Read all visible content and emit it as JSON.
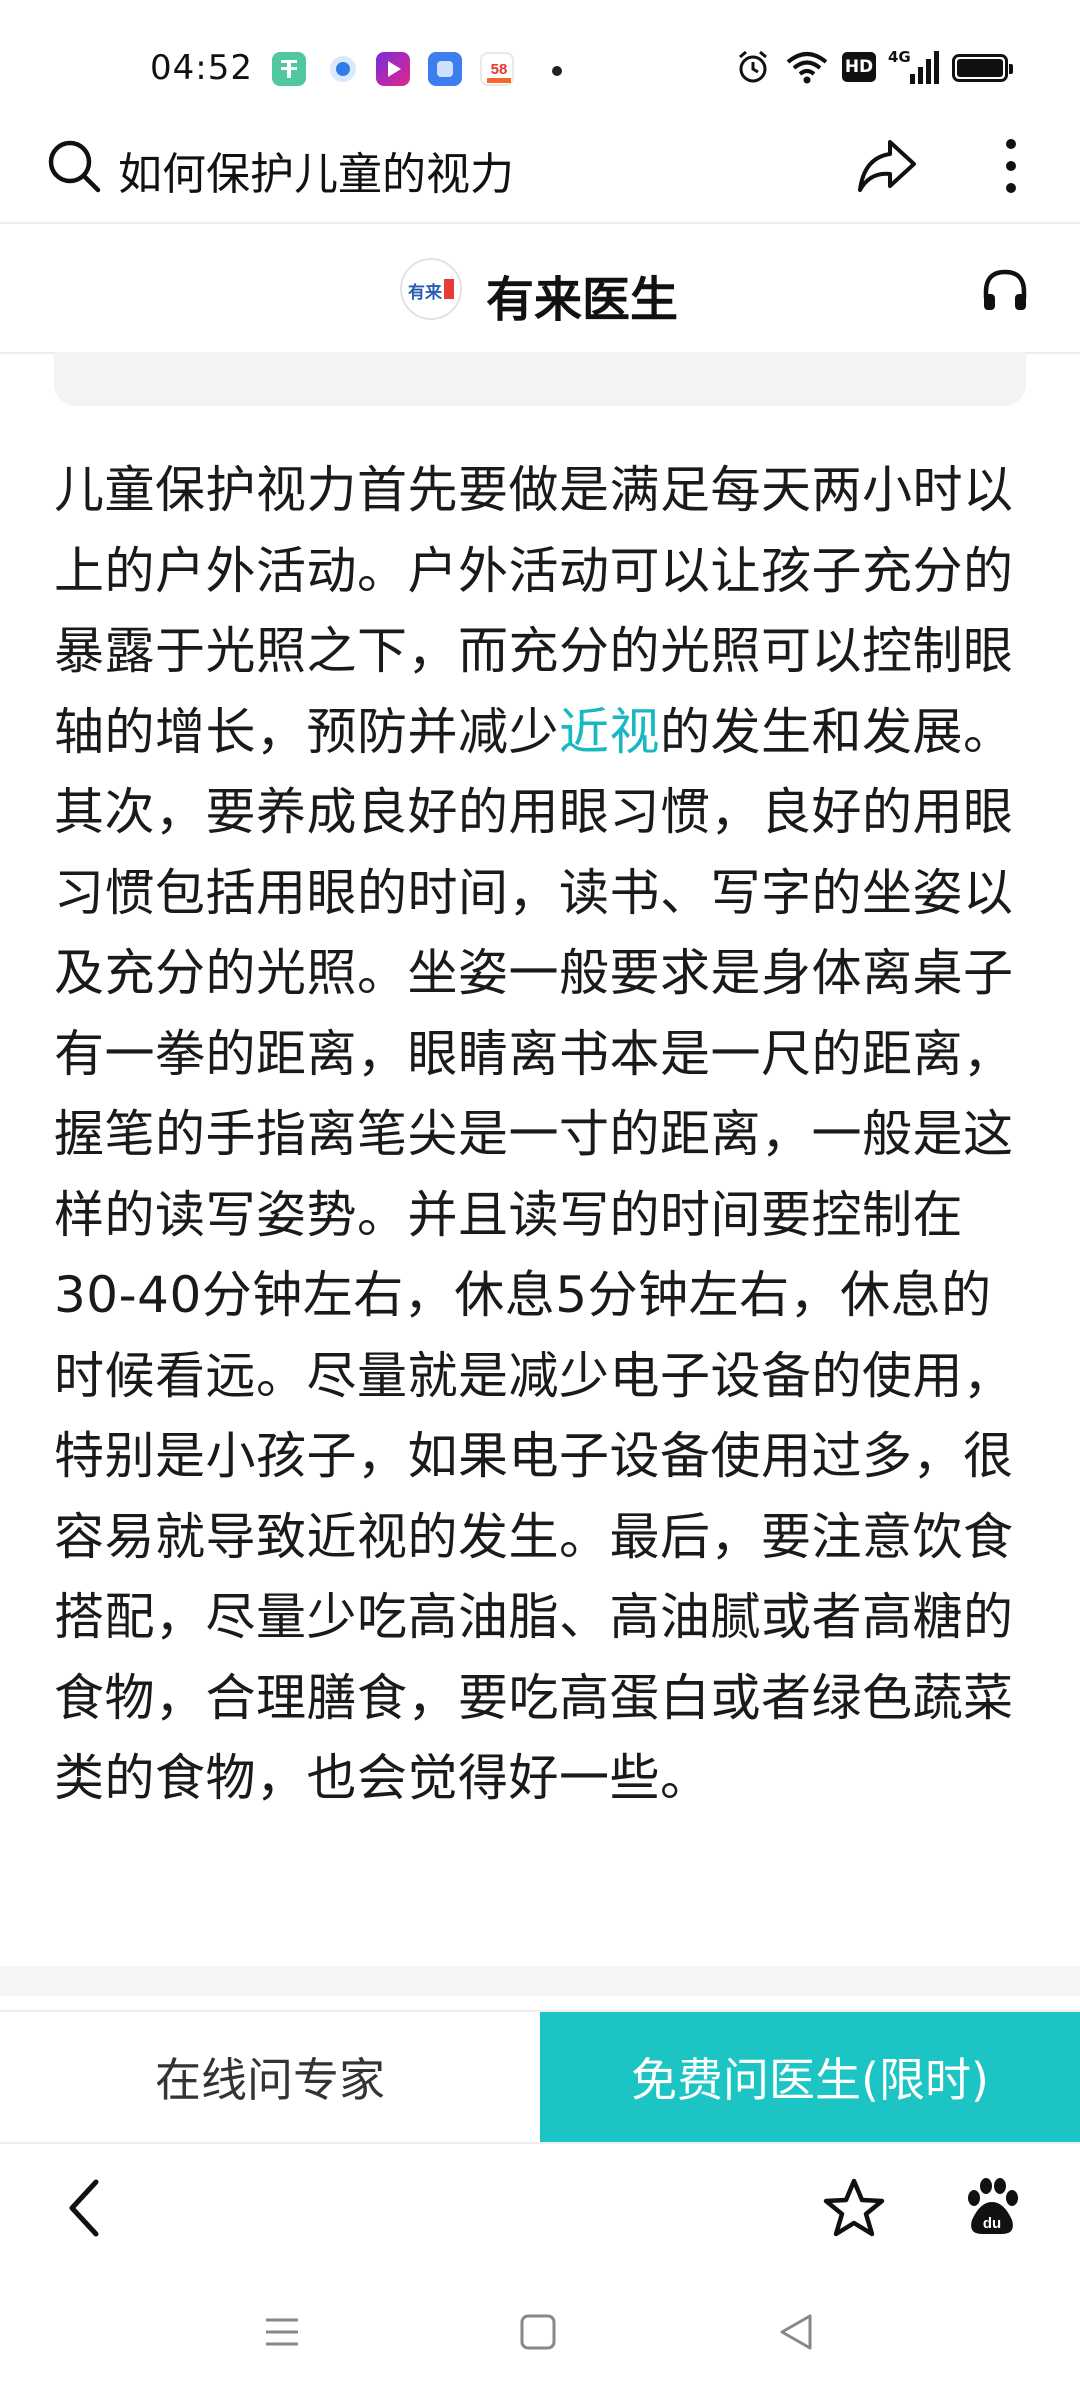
{
  "status_bar": {
    "time": "04:52",
    "apps": [
      "app-green-icon",
      "app-blue-dot-icon",
      "app-play-icon",
      "app-blue-square-icon",
      "app-58-icon"
    ],
    "app_58_label": "58",
    "indicators": [
      "alarm-icon",
      "wifi-icon",
      "hd-icon",
      "4g-signal-icon",
      "battery-icon"
    ],
    "hd_label": "HD",
    "net_label": "4G"
  },
  "search": {
    "query": "如何保护儿童的视力"
  },
  "source": {
    "logo_text": "有来",
    "name": "有来医生"
  },
  "article": {
    "part1": "儿童保护视力首先要做是满足每天两小时以上的户外活动。户外活动可以让孩子充分的暴露于光照之下，而充分的光照可以控制眼轴的增长，预防并减少",
    "link": "近视",
    "part2": "的发生和发展。其次，要养成良好的用眼习惯，良好的用眼习惯包括用眼的时间，读书、写字的坐姿以及充分的光照。坐姿一般要求是身体离桌子有一拳的距离，眼睛离书本是一尺的距离，握笔的手指离笔尖是一寸的距离，一般是这样的读写姿势。并且读写的时间要控制在30-40分钟左右，休息5分钟左右，休息的时候看远。尽量就是减少电子设备的使用，特别是小孩子，如果电子设备使用过多，很容易就导致近视的发生。最后，要注意饮食搭配，尽量少吃高油脂、高油腻或者高糖的食物，合理膳食，要吃高蛋白或者绿色蔬菜类的食物，也会觉得好一些。"
  },
  "actions": {
    "expert_label": "在线问专家",
    "free_label": "免费问医生(限时)"
  },
  "colors": {
    "accent": "#1cc4c4",
    "link": "#17b8c2"
  },
  "toolbar": {
    "icons": [
      "back-chevron-icon",
      "star-icon",
      "baidu-paw-icon"
    ]
  },
  "system_nav": {
    "icons": [
      "menu-icon",
      "home-square-icon",
      "back-triangle-icon"
    ]
  }
}
